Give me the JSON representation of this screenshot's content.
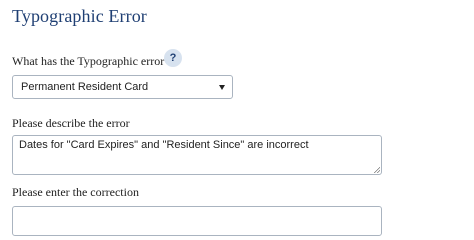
{
  "page": {
    "title": "Typographic Error"
  },
  "question": {
    "label": "What has the Typographic error ?",
    "help_icon_text": "?",
    "selected_value": "Permanent Resident Card"
  },
  "describe": {
    "label": "Please describe the error",
    "value": "Dates for \"Card Expires\" and \"Resident Since\" are incorrect"
  },
  "correction": {
    "label": "Please enter the correction",
    "value": ""
  },
  "colors": {
    "title": "#1f3f73",
    "help_bg": "#d7e2ef",
    "border": "#aab4c0"
  },
  "icons": {
    "help": "question-circle-icon",
    "dropdown": "chevron-down-icon",
    "resize": "resize-handle-icon"
  }
}
